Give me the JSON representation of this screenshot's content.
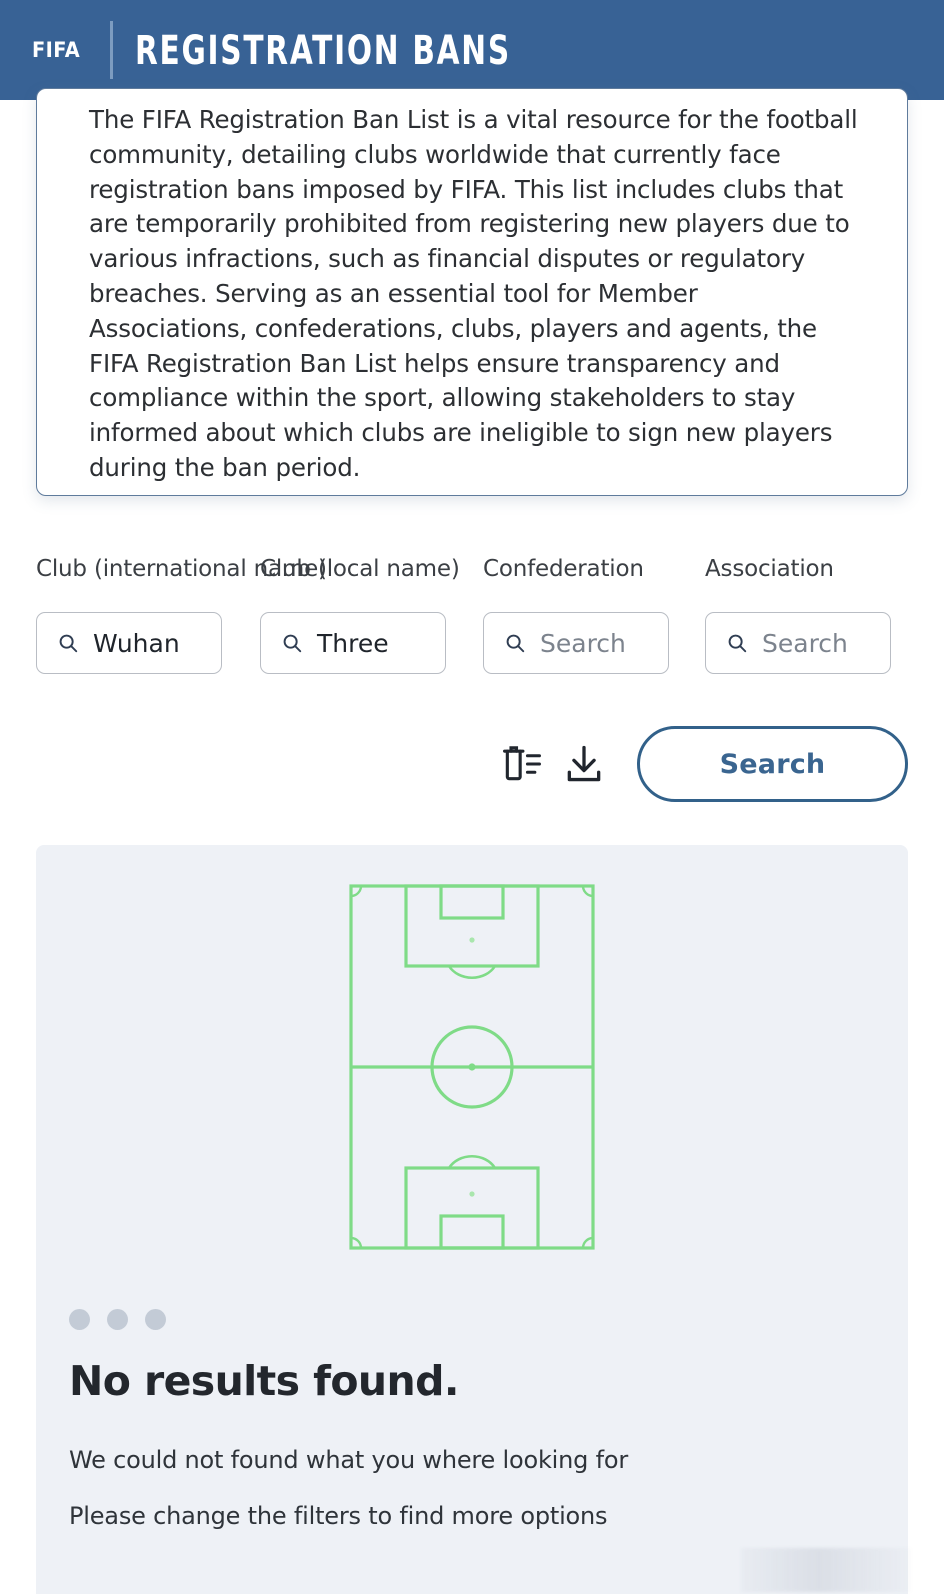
{
  "header": {
    "logo_text": "FIFA",
    "title": "REGISTRATION BANS",
    "background_color": "#386295",
    "text_color": "#ffffff"
  },
  "intro": {
    "paragraph": "The FIFA Registration Ban List is a vital resource for the football community, detailing clubs worldwide that currently face registration bans imposed by FIFA. This list includes clubs that are temporarily prohibited from registering new players due to various infractions, such as financial disputes or regulatory breaches. Serving as an essential tool for Member Associations, confederations, clubs, players and agents, the FIFA Registration Ban List helps ensure transparency and compliance within the sport, allowing stakeholders to stay informed about which clubs are ineligible to sign new players during the ban period.",
    "border_color": "#5f7b9c"
  },
  "filters": {
    "fields": [
      {
        "label": "Club (international name)",
        "value": "Wuhan",
        "placeholder": "Search",
        "icon": "search-icon",
        "has_value": true
      },
      {
        "label": "Club (local name)",
        "value": "Three",
        "placeholder": "Search",
        "icon": "search-icon",
        "has_value": true
      },
      {
        "label": "Confederation",
        "value": "",
        "placeholder": "Search",
        "icon": "search-icon",
        "has_value": false
      },
      {
        "label": "Association",
        "value": "",
        "placeholder": "Search",
        "icon": "search-icon",
        "has_value": false
      }
    ]
  },
  "actions": {
    "clear_filters_icon": "trash-list-icon",
    "download_icon": "download-icon",
    "search_label": "Search",
    "search_accent_color": "#32618a"
  },
  "results": {
    "panel_background": "#eef1f6",
    "illustration": "football-pitch-illustration",
    "illustration_color": "#7fdb87",
    "loading_dots": 3,
    "title": "No results found.",
    "message_line_1": "We could not found what you where looking for",
    "message_line_2": "Please change the filters to find more options"
  }
}
